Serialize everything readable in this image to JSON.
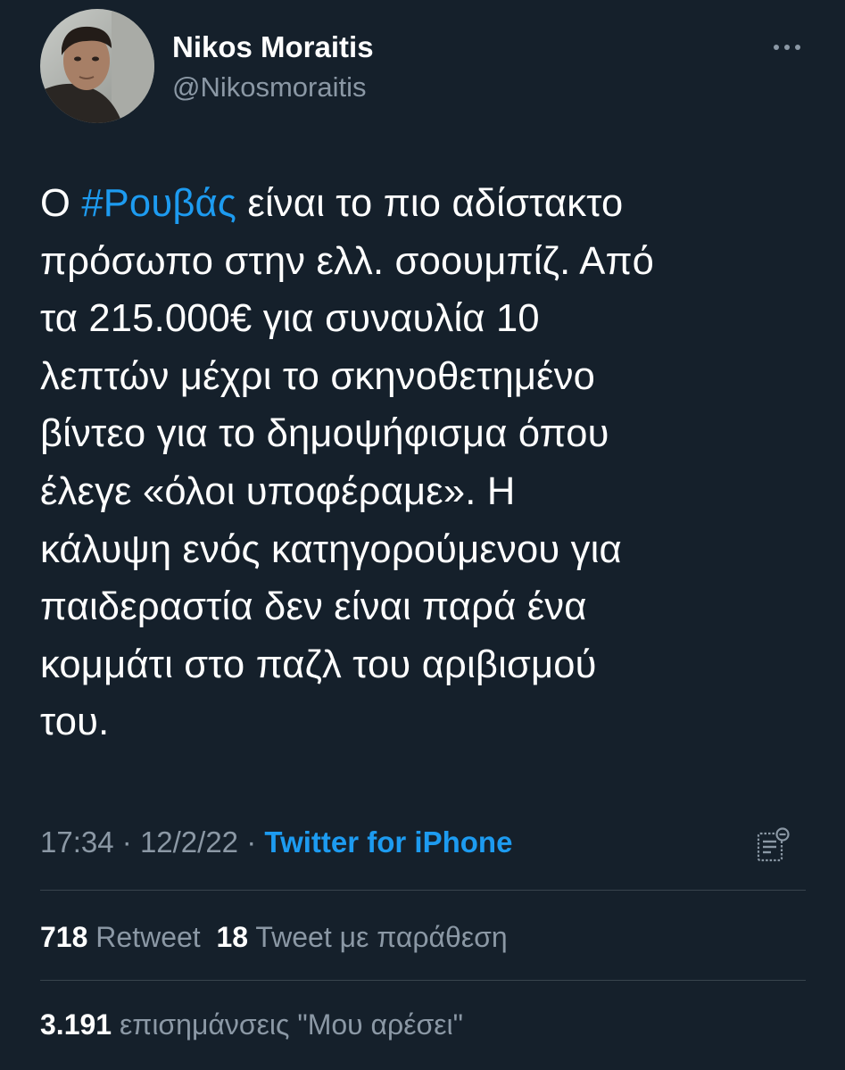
{
  "user": {
    "display_name": "Nikos Moraitis",
    "handle": "@Nikosmoraitis",
    "avatar_icon": "profile-photo"
  },
  "tweet": {
    "lines": [
      [
        {
          "text": "Ο "
        },
        {
          "text": "#Ρουβάς",
          "hashtag": true
        },
        {
          "text": " είναι το πιο αδίστακτο"
        }
      ],
      [
        {
          "text": "πρόσωπο στην ελλ. σοουμπίζ. Από"
        }
      ],
      [
        {
          "text": "τα 215.000€ για συναυλία 10"
        }
      ],
      [
        {
          "text": "λεπτών μέχρι το σκηνοθετημένο"
        }
      ],
      [
        {
          "text": "βίντεο για το δημοψήφισμα όπου"
        }
      ],
      [
        {
          "text": "έλεγε «όλοι υποφέραμε». Η"
        }
      ],
      [
        {
          "text": "κάλυψη ενός κατηγορούμενου για"
        }
      ],
      [
        {
          "text": "παιδεραστία δεν είναι παρά ένα"
        }
      ],
      [
        {
          "text": "κομμάτι στο παζλ του αριβισμού"
        }
      ],
      [
        {
          "text": "του."
        }
      ]
    ]
  },
  "meta": {
    "time": "17:34",
    "date": "12/2/22",
    "separator": "·",
    "source": "Twitter for iPhone"
  },
  "stats": {
    "retweets_count": "718",
    "retweets_label": "Retweet",
    "quotes_count": "18",
    "quotes_label": "Tweet με παράθεση",
    "likes_count": "3.191",
    "likes_label": "επισημάνσεις \"Μου αρέσει\""
  },
  "icons": {
    "more": "more-options-icon",
    "analytics": "tweet-analytics-icon"
  },
  "colors": {
    "background": "#15202b",
    "text": "#ffffff",
    "secondary": "#8b98a5",
    "accent": "#1d9bf0",
    "divider": "#38444d"
  }
}
